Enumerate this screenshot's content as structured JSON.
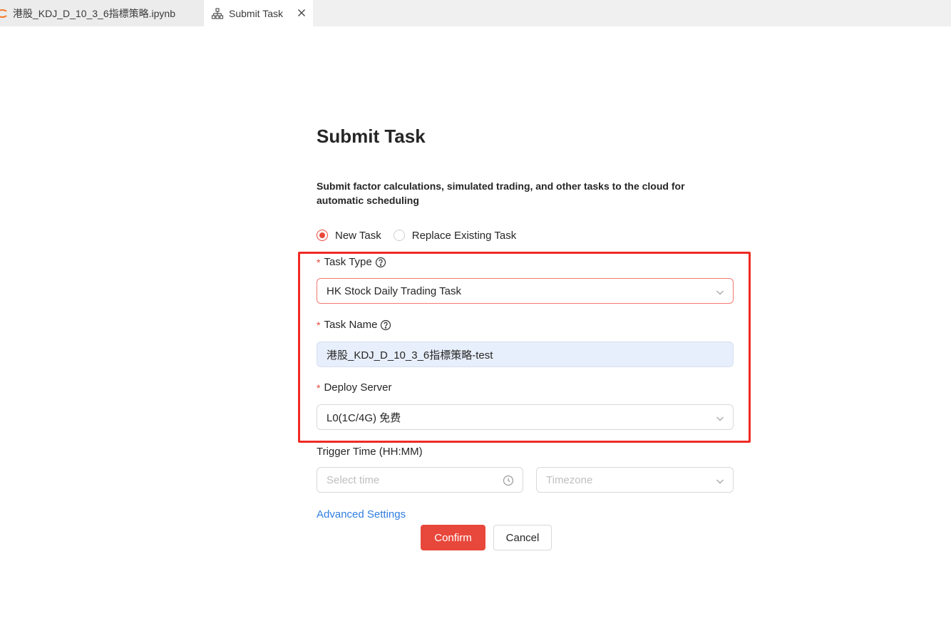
{
  "tabs": [
    {
      "label": "港股_KDJ_D_10_3_6指標策略.ipynb",
      "icon": "jupyter-notebook-icon"
    },
    {
      "label": "Submit Task",
      "icon": "sitemap-icon",
      "close_icon": "close-icon"
    }
  ],
  "form": {
    "title": "Submit Task",
    "description": "Submit factor calculations, simulated trading, and other tasks to the cloud for automatic scheduling",
    "mode_options": [
      "New Task",
      "Replace Existing Task"
    ],
    "mode_selected": "New Task",
    "required_mark": "*",
    "task_type": {
      "label": "Task Type",
      "value": "HK Stock Daily Trading Task"
    },
    "task_name": {
      "label": "Task Name",
      "value": "港股_KDJ_D_10_3_6指標策略-test"
    },
    "deploy_server": {
      "label": "Deploy Server",
      "value": "L0(1C/4G) 免费"
    },
    "trigger_time": {
      "label": "Trigger Time (HH:MM)",
      "time_placeholder": "Select time",
      "timezone_placeholder": "Timezone"
    },
    "advanced_link": "Advanced Settings",
    "confirm_label": "Confirm",
    "cancel_label": "Cancel"
  },
  "colors": {
    "accent": "#e8483b",
    "link": "#2f7de1",
    "highlight_border": "#ee2b24",
    "filled_input_bg": "#e8effc"
  }
}
